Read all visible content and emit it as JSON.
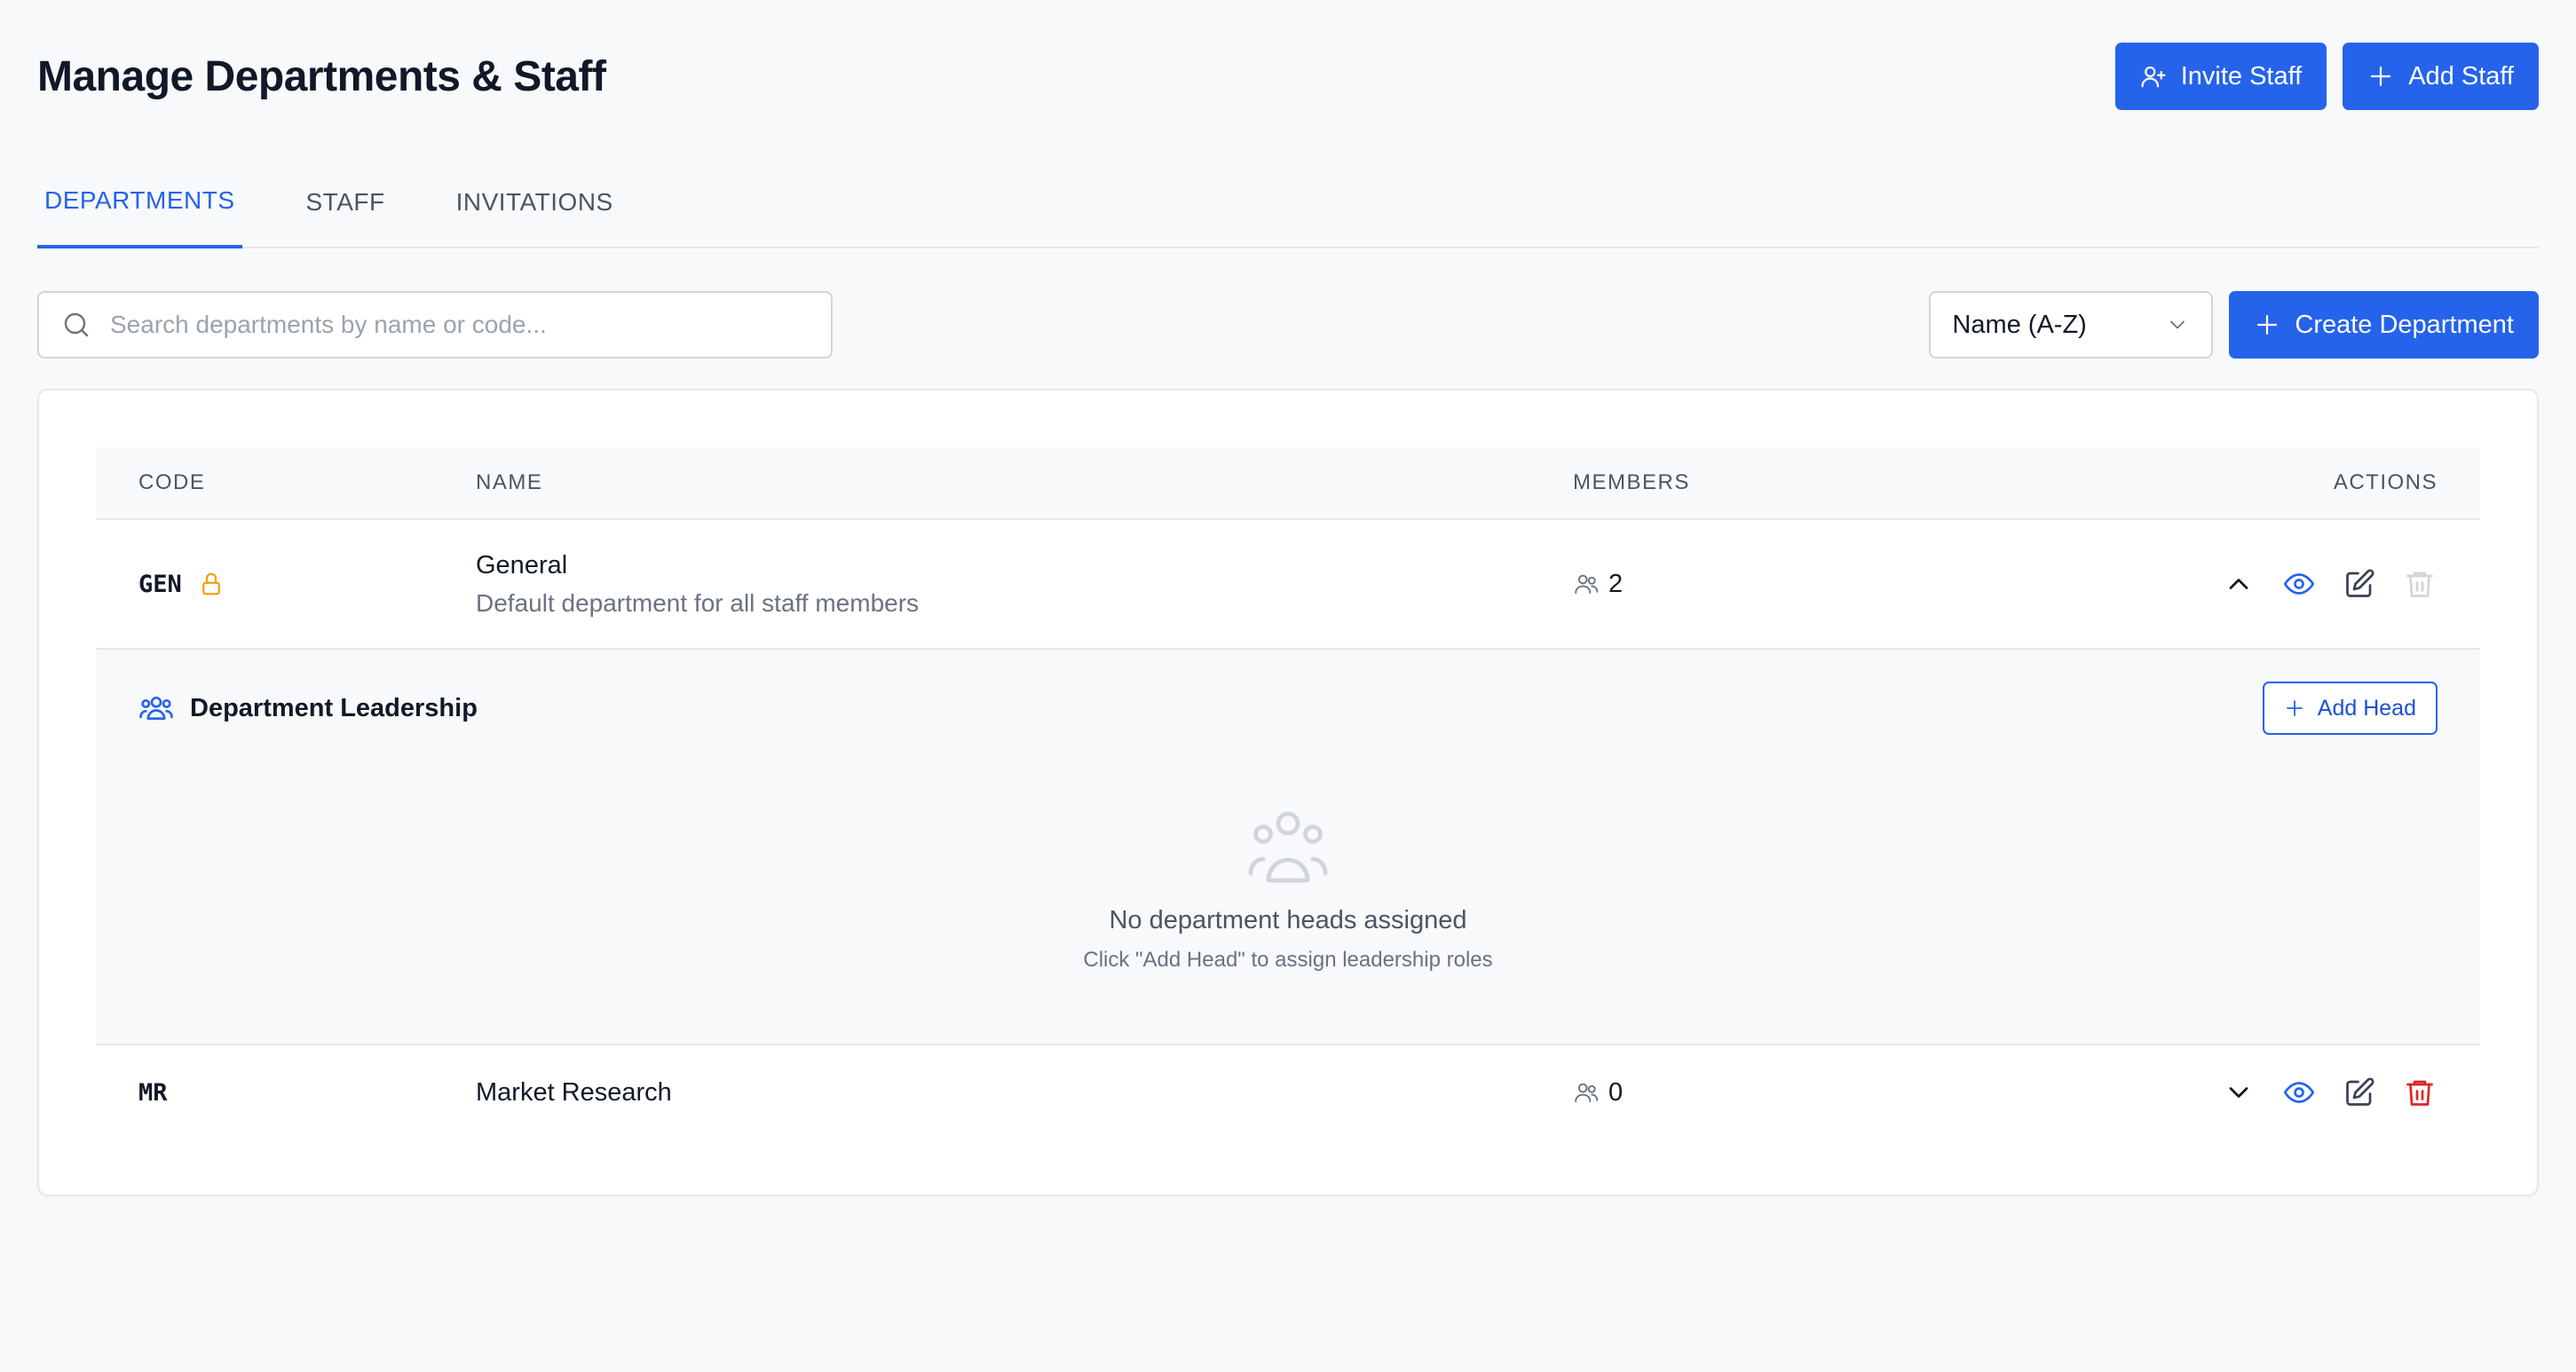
{
  "header": {
    "title": "Manage Departments & Staff",
    "invite_label": "Invite Staff",
    "add_label": "Add Staff"
  },
  "tabs": [
    {
      "label": "DEPARTMENTS",
      "active": true
    },
    {
      "label": "STAFF",
      "active": false
    },
    {
      "label": "INVITATIONS",
      "active": false
    }
  ],
  "toolbar": {
    "search_placeholder": "Search departments by name or code...",
    "search_value": "",
    "sort_selected": "Name (A-Z)",
    "create_label": "Create Department"
  },
  "table": {
    "columns": [
      "CODE",
      "NAME",
      "MEMBERS",
      "ACTIONS"
    ],
    "rows": [
      {
        "code": "GEN",
        "locked": true,
        "name": "General",
        "description": "Default department for all staff members",
        "members": "2",
        "expanded": true
      },
      {
        "code": "MR",
        "locked": false,
        "name": "Market Research",
        "description": "",
        "members": "0",
        "expanded": false
      }
    ]
  },
  "leadership": {
    "title": "Department Leadership",
    "add_head_label": "Add Head",
    "empty_title": "No department heads assigned",
    "empty_subtitle": "Click \"Add Head\" to assign leadership roles"
  },
  "colors": {
    "primary": "#2563eb",
    "lock": "#f59e0b",
    "danger": "#dc2626",
    "danger_disabled": "#d1d5db",
    "muted_icon": "#9ca3af"
  },
  "icons": {
    "invite": "user-plus-icon",
    "add": "plus-icon",
    "search": "search-icon",
    "sort": "chevron-down-icon",
    "lock": "lock-icon",
    "members": "users-icon",
    "expand": "chevron-icon",
    "view": "eye-icon",
    "edit": "edit-icon",
    "delete": "trash-icon",
    "leadership": "users-group-icon"
  }
}
